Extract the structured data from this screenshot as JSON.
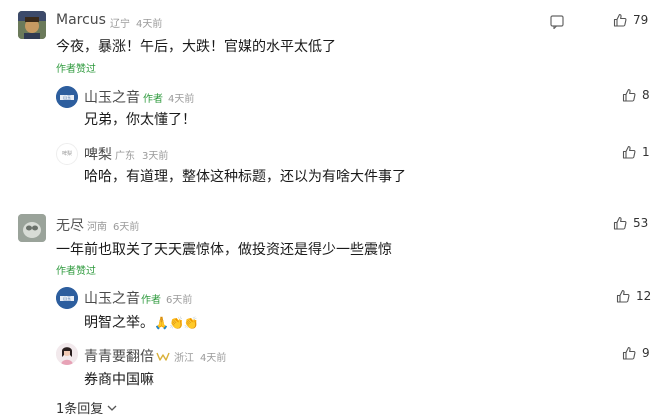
{
  "comments": [
    {
      "user": "Marcus",
      "location": "辽宁",
      "time": "4天前",
      "text": "今夜，暴涨！午后，大跌！官媒的水平太低了",
      "author_liked": "作者赞过",
      "likes": "79",
      "replies": [
        {
          "user": "山玉之音",
          "tag": "作者",
          "time": "4天前",
          "text": "兄弟，你太懂了！",
          "likes": "8"
        },
        {
          "user": "啤梨",
          "avatar_text": "啤梨",
          "location": "广东",
          "time": "3天前",
          "text": "哈哈，有道理，整体这种标题，还以为有啥大件事了",
          "likes": "1"
        }
      ]
    },
    {
      "user": "无尽",
      "location": "河南",
      "time": "6天前",
      "text": "一年前也取关了天天震惊体，做投资还是得少一些震惊",
      "author_liked": "作者赞过",
      "likes": "53",
      "replies": [
        {
          "user": "山玉之音",
          "tag": "作者",
          "time": "6天前",
          "text": "明智之举。",
          "emoji": "🙏👏👏",
          "likes": "12"
        },
        {
          "user": "青青要翻倍",
          "location": "浙江",
          "time": "4天前",
          "text": "券商中国嘛",
          "likes": "9"
        }
      ],
      "more_replies": "1条回复"
    }
  ],
  "colors": {
    "accent_green": "#2e9a3d",
    "meta_gray": "#9a9a9a"
  }
}
